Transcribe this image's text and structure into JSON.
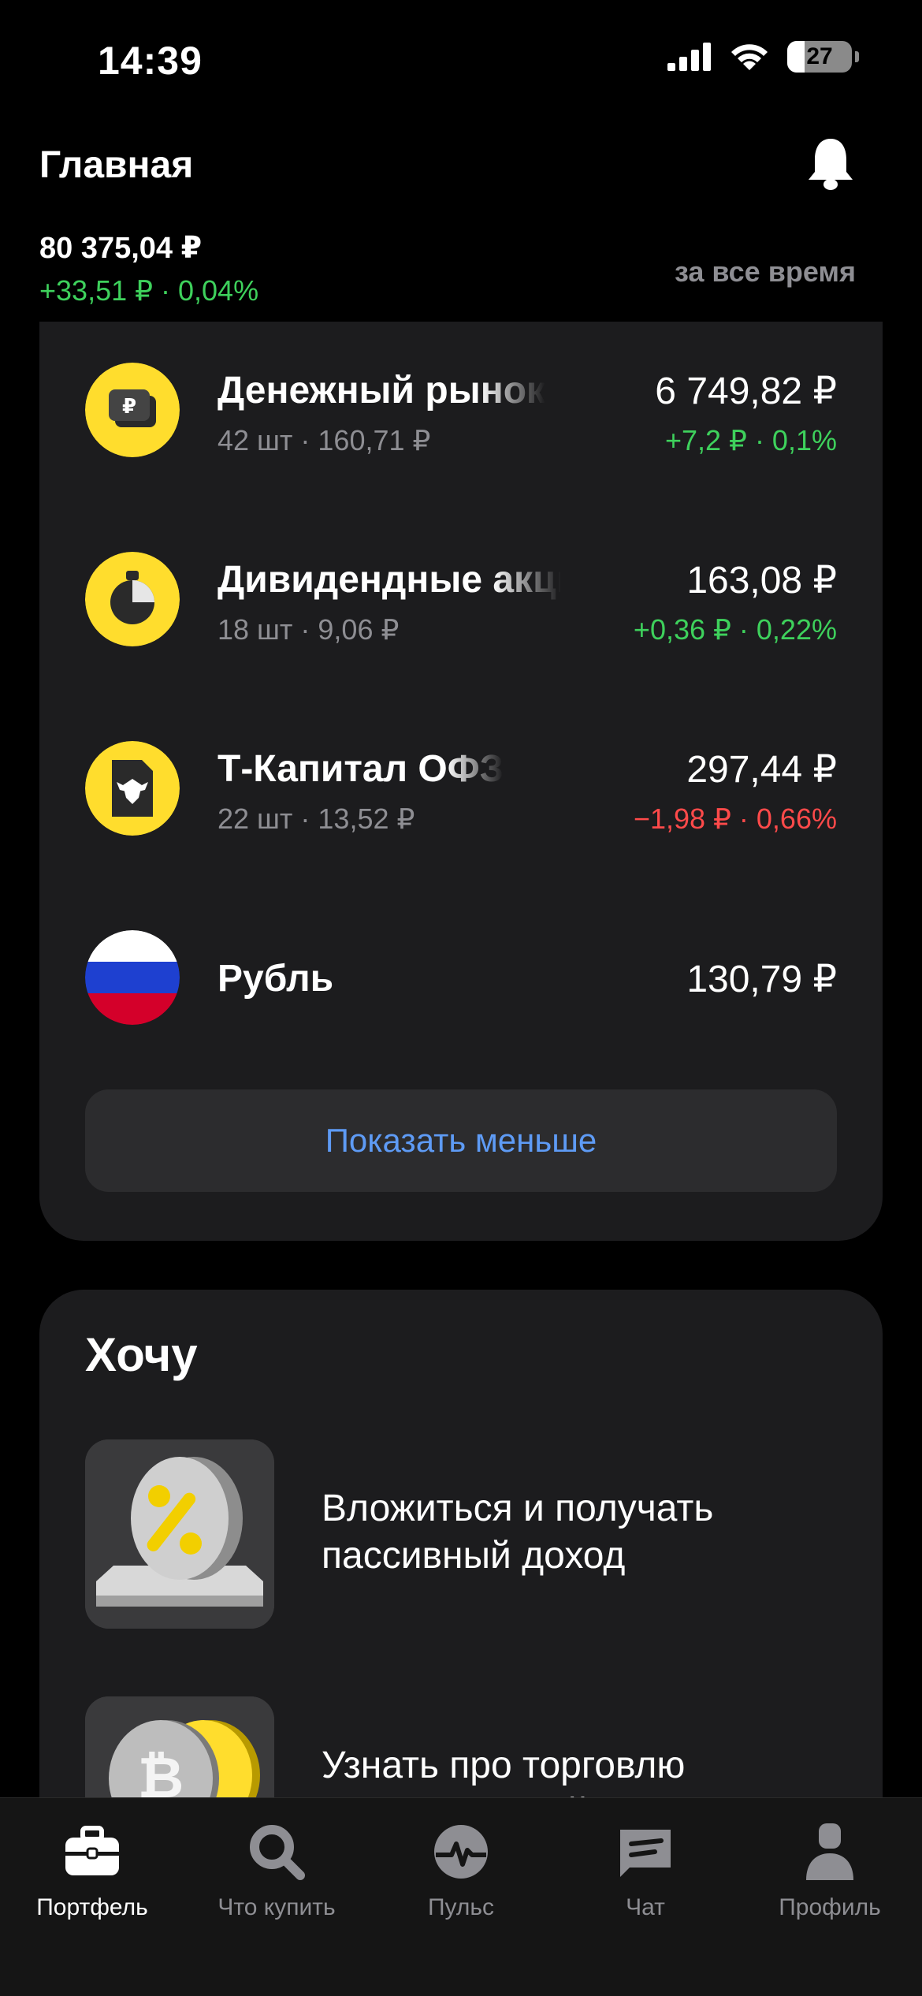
{
  "status_bar": {
    "time": "14:39",
    "battery": "27",
    "battery_level": 0.27
  },
  "header": {
    "title": "Главная",
    "total_value": "80 375,04 ₽",
    "total_change": "+33,51 ₽ · 0,04%",
    "period": "за все время"
  },
  "portfolio": {
    "assets": [
      {
        "name": "Денежный рынок",
        "sub": "42 шт · 160,71 ₽",
        "value": "6 749,82 ₽",
        "change": "+7,2 ₽ · 0,1%",
        "trend": "up"
      },
      {
        "name": "Дивидендные акции",
        "sub": "18 шт · 9,06 ₽",
        "value": "163,08 ₽",
        "change": "+0,36 ₽ · 0,22%",
        "trend": "up"
      },
      {
        "name": "Т-Капитал ОФЗ",
        "sub": "22 шт · 13,52 ₽",
        "value": "297,44 ₽",
        "change": "−1,98 ₽ · 0,66%",
        "trend": "down"
      },
      {
        "name": "Рубль",
        "value": "130,79 ₽"
      }
    ],
    "show_less": "Показать меньше"
  },
  "want": {
    "title": "Хочу",
    "items": [
      {
        "text_line1": "Вложиться и получать",
        "text_line2": "пассивный доход"
      },
      {
        "text_line1": "Узнать про торговлю",
        "text_line2": "криптовалютой"
      }
    ]
  },
  "tab_bar": {
    "tabs": [
      {
        "label": "Портфель",
        "active": true
      },
      {
        "label": "Что купить"
      },
      {
        "label": "Пульс"
      },
      {
        "label": "Чат"
      },
      {
        "label": "Профиль"
      }
    ]
  },
  "colors": {
    "accent_yellow": "#ffdd2d",
    "positive": "#3ed15c",
    "negative": "#ff4a4a",
    "link": "#5e9bf5"
  }
}
